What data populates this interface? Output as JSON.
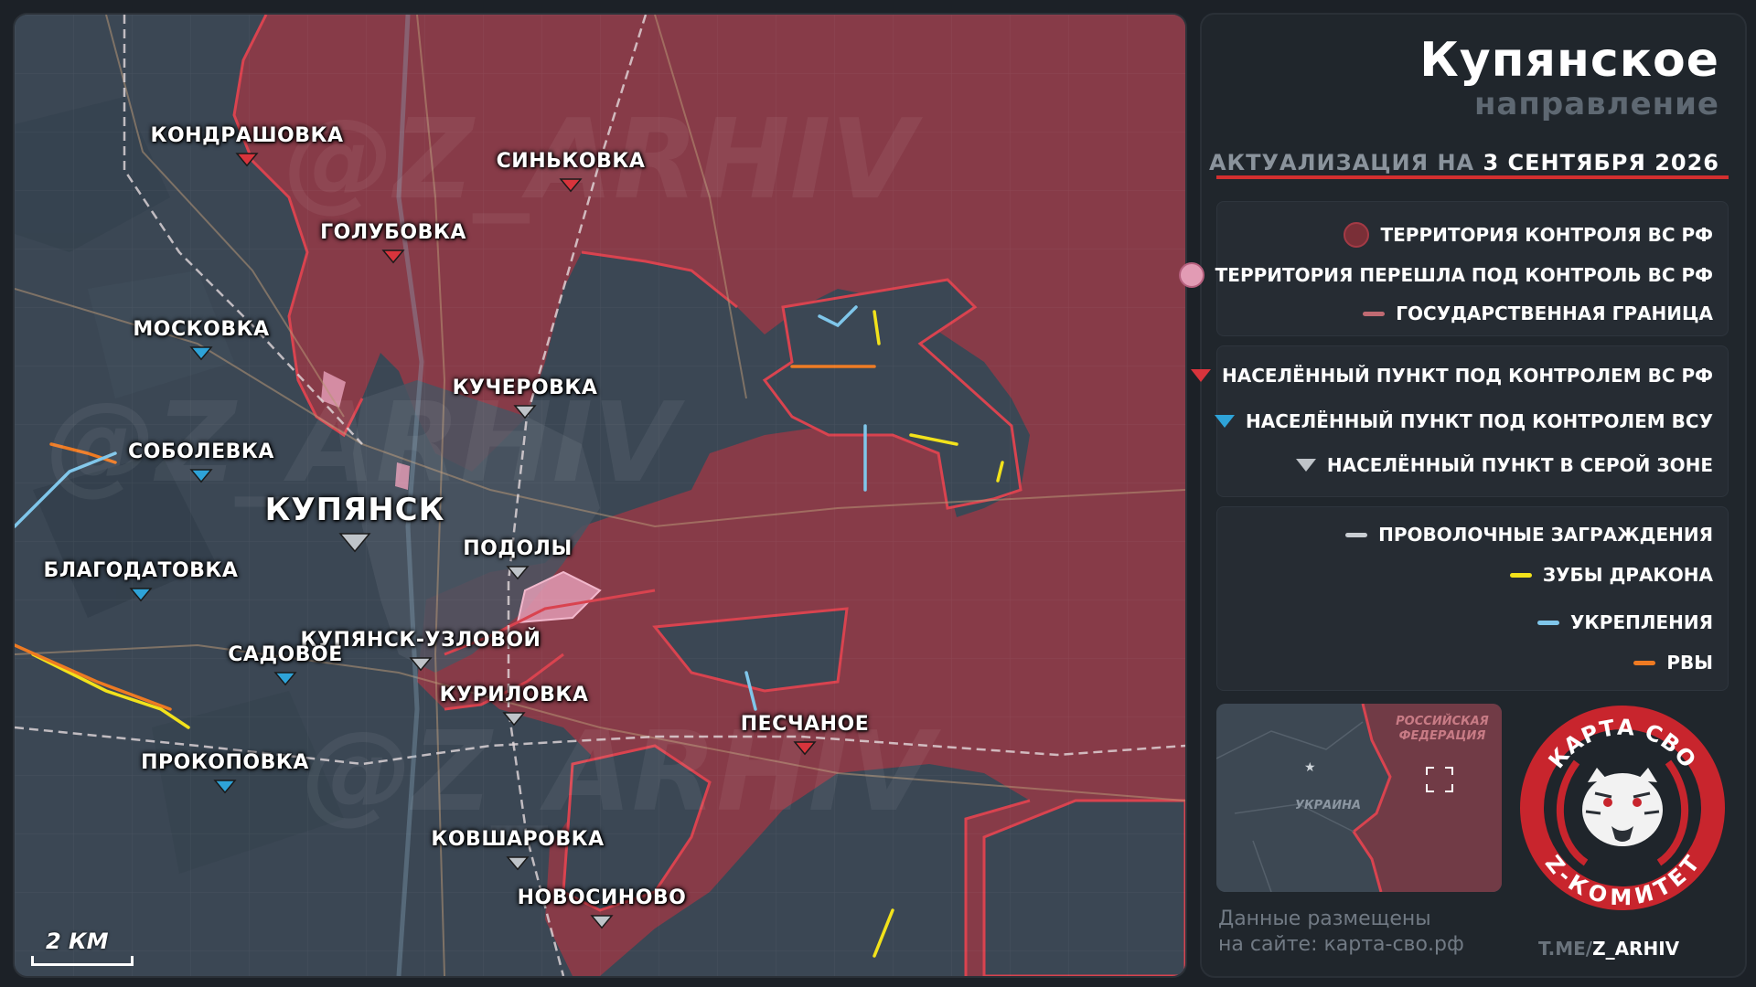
{
  "title": {
    "main": "Купянское",
    "sub": "направление"
  },
  "update": {
    "prefix": "АКТУАЛИЗАЦИЯ НА",
    "date": "3 СЕНТЯБРЯ 2026"
  },
  "legend": {
    "territory": [
      {
        "label": "ТЕРРИТОРИЯ КОНТРОЛЯ ВС РФ",
        "color": "#a33a45"
      },
      {
        "label": "ТЕРРИТОРИЯ ПЕРЕШЛА ПОД КОНТРОЛЬ ВС РФ",
        "color": "#e29bb4"
      },
      {
        "label": "ГОСУДАРСТВЕННАЯ ГРАНИЦА",
        "color": "#c06a72"
      }
    ],
    "settlements": [
      {
        "label": "НАСЕЛЁННЫЙ ПУНКТ ПОД КОНТРОЛЕМ ВС РФ",
        "color": "#d8343c"
      },
      {
        "label": "НАСЕЛЁННЫЙ ПУНКТ ПОД КОНТРОЛЕМ ВСУ",
        "color": "#2ea3d8"
      },
      {
        "label": "НАСЕЛЁННЫЙ ПУНКТ В СЕРОЙ ЗОНЕ",
        "color": "#bfc4c9"
      }
    ],
    "fortifications": [
      {
        "label": "ПРОВОЛОЧНЫЕ ЗАГРАЖДЕНИЯ",
        "color": "#c9ced3"
      },
      {
        "label": "ЗУБЫ ДРАКОНА",
        "color": "#f2e21b"
      },
      {
        "label": "УКРЕПЛЕНИЯ",
        "color": "#7fc6ea"
      },
      {
        "label": "РВЫ",
        "color": "#ee7a22"
      }
    ]
  },
  "inset": {
    "russia": "РОССИЙСКАЯ ФЕДЕРАЦИЯ",
    "ukraine": "УКРАИНА"
  },
  "site": {
    "line1": "Данные размещены",
    "line2": "на сайте: карта-сво.рф"
  },
  "logo": {
    "top": "КАРТА СВО",
    "bottom": "Z-КОМИТЕТ"
  },
  "telegram": {
    "prefix": "T.ME/",
    "handle": "Z_ARHIV"
  },
  "watermark": "@Z_ARHIV",
  "scale": {
    "label": "2 КМ"
  },
  "towns": [
    {
      "id": "kondrashovka",
      "name": "КОНДРАШОВКА",
      "status": "rf"
    },
    {
      "id": "sinkovka",
      "name": "СИНЬКОВКА",
      "status": "rf"
    },
    {
      "id": "golubovka",
      "name": "ГОЛУБОВКА",
      "status": "rf"
    },
    {
      "id": "moskovka",
      "name": "МОСКОВКА",
      "status": "ua"
    },
    {
      "id": "kucherovka",
      "name": "КУЧЕРОВКА",
      "status": "grey"
    },
    {
      "id": "sobolevka",
      "name": "СОБОЛЕВКА",
      "status": "ua"
    },
    {
      "id": "kupyansk",
      "name": "КУПЯНСК",
      "status": "grey"
    },
    {
      "id": "podoly",
      "name": "ПОДОЛЫ",
      "status": "grey"
    },
    {
      "id": "blagodatovka",
      "name": "БЛАГОДАТОВКА",
      "status": "ua"
    },
    {
      "id": "kupyansk-uzlovoy",
      "name": "КУПЯНСК-УЗЛОВОЙ",
      "status": "grey"
    },
    {
      "id": "sadovoe",
      "name": "САДОВОЕ",
      "status": "ua"
    },
    {
      "id": "kurilovka",
      "name": "КУРИЛОВКА",
      "status": "grey"
    },
    {
      "id": "peschanoe",
      "name": "ПЕСЧАНОЕ",
      "status": "rf"
    },
    {
      "id": "prokopovka",
      "name": "ПРОКОПОВКА",
      "status": "ua"
    },
    {
      "id": "kovsharovka",
      "name": "КОВШАРОВКА",
      "status": "grey"
    },
    {
      "id": "novosinovo",
      "name": "НОВОСИНОВО",
      "status": "grey"
    }
  ]
}
